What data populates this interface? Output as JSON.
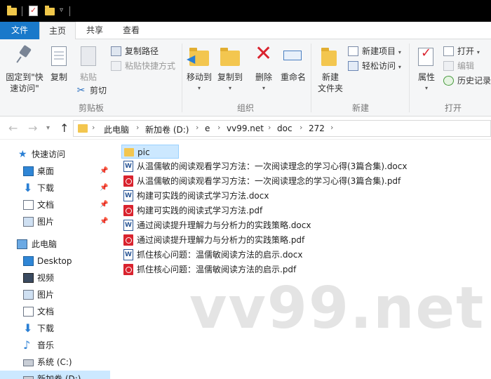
{
  "ribbon_tabs": {
    "file": "文件",
    "home": "主页",
    "share": "共享",
    "view": "查看"
  },
  "clipboard": {
    "pin": "固定到\"快",
    "pin2": "速访问\"",
    "copy": "复制",
    "paste": "粘贴",
    "copy_path": "复制路径",
    "paste_shortcut": "粘贴快捷方式",
    "cut": "剪切",
    "label": "剪贴板"
  },
  "organize": {
    "move_to": "移动到",
    "copy_to": "复制到",
    "delete": "删除",
    "rename": "重命名",
    "label": "组织"
  },
  "new": {
    "new_folder": "新建",
    "new_folder2": "文件夹",
    "new_item": "新建项目",
    "easy_access": "轻松访问",
    "label": "新建"
  },
  "open": {
    "properties": "属性",
    "open": "打开",
    "edit": "编辑",
    "history": "历史记录",
    "label": "打开"
  },
  "address": {
    "crumbs": [
      "此电脑",
      "新加卷 (D:)",
      "e",
      "vv99.net",
      "doc",
      "272"
    ]
  },
  "nav": {
    "quick_access": "快速访问",
    "desktop": "桌面",
    "downloads": "下载",
    "documents": "文档",
    "pictures": "图片",
    "this_pc": "此电脑",
    "pc_desktop": "Desktop",
    "videos": "视频",
    "pc_pictures": "图片",
    "pc_documents": "文档",
    "pc_downloads": "下载",
    "music": "音乐",
    "system_c": "系统 (C:)",
    "new_volume_d": "新加卷 (D:)"
  },
  "files": [
    {
      "name": "pic",
      "type": "folder"
    },
    {
      "name": "从温儒敏的阅读观看学习方法：一次阅读理念的学习心得(3篇合集).docx",
      "type": "docx"
    },
    {
      "name": "从温儒敏的阅读观看学习方法：一次阅读理念的学习心得(3篇合集).pdf",
      "type": "pdf"
    },
    {
      "name": "构建可实践的阅读式学习方法.docx",
      "type": "docx"
    },
    {
      "name": "构建可实践的阅读式学习方法.pdf",
      "type": "pdf"
    },
    {
      "name": "通过阅读提升理解力与分析力的实践策略.docx",
      "type": "docx"
    },
    {
      "name": "通过阅读提升理解力与分析力的实践策略.pdf",
      "type": "pdf"
    },
    {
      "name": "抓住核心问题：温儒敏阅读方法的启示.docx",
      "type": "docx"
    },
    {
      "name": "抓住核心问题：温儒敏阅读方法的启示.pdf",
      "type": "pdf"
    }
  ],
  "watermark": "vv99.net",
  "colors": {
    "accent": "#1979ca",
    "selection": "#cce8ff",
    "folder": "#f3c64f",
    "pdf": "#d9232e",
    "word": "#2b5797"
  }
}
